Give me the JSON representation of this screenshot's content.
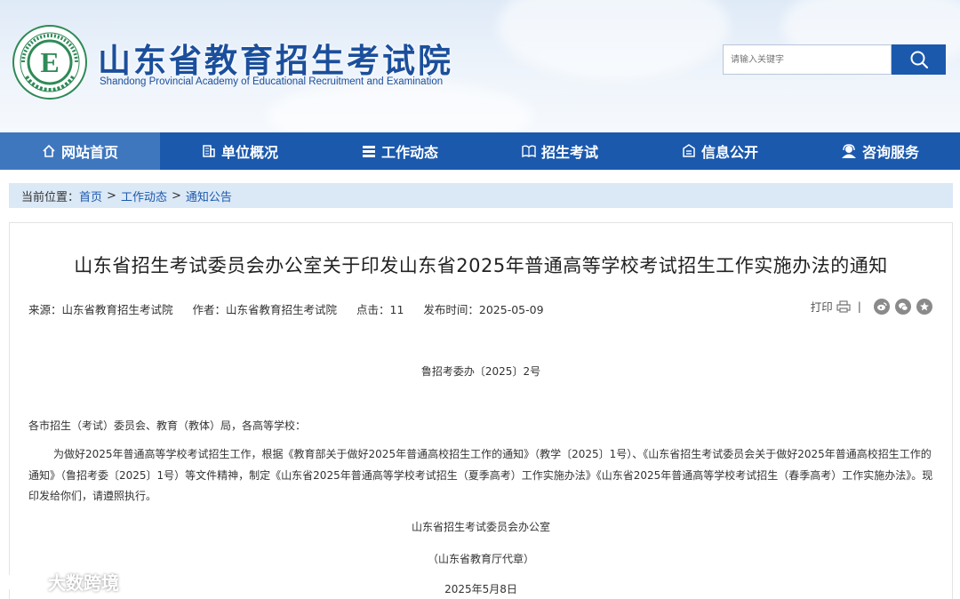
{
  "header": {
    "title": "山东省教育招生考试院",
    "subtitle": "Shandong Provincial Academy of Educational Recruitment and Examination",
    "logo_letter": "E",
    "search_placeholder": "请输入关键字"
  },
  "nav": {
    "items": [
      {
        "label": "网站首页",
        "icon": "home-icon"
      },
      {
        "label": "单位概况",
        "icon": "building-icon"
      },
      {
        "label": "工作动态",
        "icon": "news-icon"
      },
      {
        "label": "招生考试",
        "icon": "book-icon"
      },
      {
        "label": "信息公开",
        "icon": "info-icon"
      },
      {
        "label": "咨询服务",
        "icon": "service-icon"
      }
    ]
  },
  "breadcrumb": {
    "prefix": "当前位置：",
    "items": [
      "首页",
      "工作动态",
      "通知公告"
    ],
    "separator": ">"
  },
  "article": {
    "title": "山东省招生考试委员会办公室关于印发山东省2025年普通高等学校考试招生工作实施办法的通知",
    "meta": {
      "source": "来源：山东省教育招生考试院",
      "author": "作者：山东省教育招生考试院",
      "clicks": "点击：11",
      "published": "发布时间：2025-05-09"
    },
    "print_label": "打印",
    "doc_number": "鲁招考委办〔2025〕2号",
    "addressee": "各市招生（考试）委员会、教育（教体）局，各高等学校：",
    "body": "为做好2025年普通高等学校考试招生工作，根据《教育部关于做好2025年普通高校招生工作的通知》（教学〔2025〕1号）、《山东省招生考试委员会关于做好2025年普通高校招生工作的通知》（鲁招考委〔2025〕1号）等文件精神，制定《山东省2025年普通高等学校考试招生（夏季高考）工作实施办法》《山东省2025年普通高等学校考试招生（春季高考）工作实施办法》。现印发给你们，请遵照执行。",
    "signature": "山东省招生考试委员会办公室",
    "seal_note": "（山东省教育厅代章）",
    "date": "2025年5月8日"
  },
  "watermark": "大数跨境",
  "colors": {
    "primary": "#1b59ad",
    "nav_active": "#3f77bf",
    "breadcrumb_bg": "#dbe8f6"
  }
}
